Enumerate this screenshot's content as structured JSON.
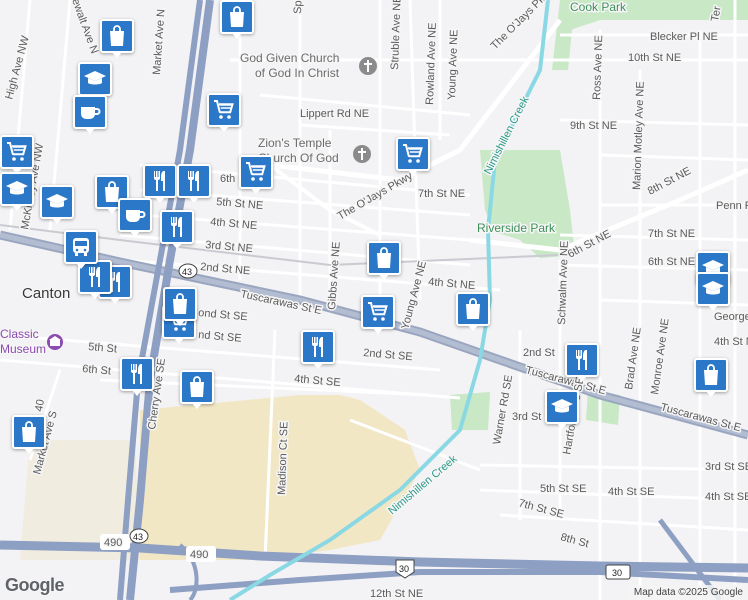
{
  "map": {
    "attribution": "Map data ©2025 Google",
    "logo_text": "Google",
    "city_label": "Canton",
    "museum_label": "Classic\nMuseum",
    "museum_label_lines": [
      "Classic",
      "Museum"
    ],
    "colors": {
      "background": "#f3f2f4",
      "park": "#c9e8c6",
      "industrial": "#f2e7c5",
      "water": "#8ad8e4",
      "highway": "#8d9fc2",
      "marker": "#2b77c8"
    },
    "places": {
      "church_1": [
        "God Given Church",
        "of God In Christ"
      ],
      "church_2": [
        "Zion's Temple",
        "Church Of God"
      ],
      "park_1": "Cook Park",
      "park_2": "Riverside Park",
      "creek": "Nimishillen Creek"
    },
    "streets": {
      "tuscarawas_w": "Tuscarawas St E",
      "tuscarawas_e": "Tuscarawas St E",
      "tuscarawas_far": "Tuscarawas St E",
      "oj_1": "The O'Jays Pkwy",
      "oj_2": "The O'Jays Pkwy",
      "market": "Market Ave N",
      "cherry": "Cherry Ave SE",
      "madison": "Madison Ct SE",
      "gibbs": "Gibbs Ave NE",
      "young_s": "Young Ave NE",
      "young_n": "Young Ave NE",
      "rowland": "Rowland Ave NE",
      "struble": "Struble Ave NE",
      "warner": "Warner Rd SE",
      "schwalm": "Schwalm Ave NE",
      "hartford": "Hartford Ave SE",
      "brad": "Brad Ave NE",
      "monroe": "Monroe Ave NE",
      "ross": "Ross Ave NE",
      "marion": "Marion Motley Ave NE",
      "high": "High Ave NW",
      "mckinley": "McKinley Ave NW",
      "market_s": "Market Ave S",
      "lippert": "Lippert Rd NE",
      "bleck": "Blecker Pl NE",
      "tenth": "10th St NE",
      "ninth": "9th St NE",
      "eighth": "8th St NE",
      "penn": "Penn Pl",
      "seventh_w": "7th St NE",
      "seventh_e": "7th St NE",
      "sixth_w": "6th St NE",
      "sixth_m": "6th St NE",
      "sixth_e": "6th St NE",
      "fifth": "5th St NE",
      "fourth_w": "4th St NE",
      "fourth_m": "4th St NE",
      "fourth_e": "4th St N",
      "third": "3rd St NE",
      "second_w": "2nd St NE",
      "second_se": "2nd St SE",
      "second_e": "2nd St",
      "second_e2": "2nd",
      "third_se_w": "3rd St SE",
      "third_se_e": "3rd St SE",
      "fourth_se": "4th St SE",
      "fourth_se_e": "4th St SE",
      "fifth_st": "5th St",
      "sixth_st": "6th St",
      "fifth_se": "5th St SE",
      "seventh_se": "7th St SE",
      "eighth_st": "8th St",
      "twelfth": "12th St NE",
      "fourth_st_se_w": "4th St SE",
      "george": "George",
      "fourth_n_e": "4th St N",
      "twond": "2nd St SE",
      "ond": "ond St SE",
      "nd": "nd St SE",
      "third_st_se": "3rd St SE",
      "sp": "Sp",
      "ewalt": "ewalt Ave N",
      "fourty": "40",
      "ter": "Ter"
    },
    "shields": {
      "i490_w": "490",
      "i490_e": "490",
      "us30_w": "30",
      "us30_e": "30",
      "sr43_n": "43",
      "sr43_s": "43"
    },
    "markers": [
      {
        "type": "restaurant",
        "icon": "fork-knife-icon",
        "id": "m1"
      },
      {
        "type": "restaurant",
        "icon": "fork-knife-icon",
        "id": "m2"
      },
      {
        "type": "restaurant",
        "icon": "fork-knife-icon",
        "id": "m3"
      },
      {
        "type": "restaurant",
        "icon": "fork-knife-icon",
        "id": "m4"
      },
      {
        "type": "restaurant",
        "icon": "fork-knife-icon",
        "id": "m5"
      },
      {
        "type": "restaurant",
        "icon": "fork-knife-icon",
        "id": "m6"
      },
      {
        "type": "restaurant",
        "icon": "fork-knife-icon",
        "id": "m7"
      },
      {
        "type": "restaurant",
        "icon": "fork-knife-icon",
        "id": "m8"
      },
      {
        "type": "grocery",
        "icon": "shopping-cart-icon",
        "id": "m9"
      },
      {
        "type": "grocery",
        "icon": "shopping-cart-icon",
        "id": "m10"
      },
      {
        "type": "grocery",
        "icon": "shopping-cart-icon",
        "id": "m11"
      },
      {
        "type": "grocery",
        "icon": "shopping-cart-icon",
        "id": "m12"
      },
      {
        "type": "grocery",
        "icon": "shopping-cart-icon",
        "id": "m13"
      },
      {
        "type": "grocery",
        "icon": "shopping-cart-icon",
        "id": "m14"
      },
      {
        "type": "shopping",
        "icon": "shopping-bag-icon",
        "id": "m15"
      },
      {
        "type": "shopping",
        "icon": "shopping-bag-icon",
        "id": "m16"
      },
      {
        "type": "shopping",
        "icon": "shopping-bag-icon",
        "id": "m17"
      },
      {
        "type": "shopping",
        "icon": "shopping-bag-icon",
        "id": "m18"
      },
      {
        "type": "shopping",
        "icon": "shopping-bag-icon",
        "id": "m19"
      },
      {
        "type": "shopping",
        "icon": "shopping-bag-icon",
        "id": "m20"
      },
      {
        "type": "shopping",
        "icon": "shopping-bag-icon",
        "id": "m21"
      },
      {
        "type": "shopping",
        "icon": "shopping-bag-icon",
        "id": "m22"
      },
      {
        "type": "shopping",
        "icon": "shopping-bag-icon",
        "id": "m23"
      },
      {
        "type": "school",
        "icon": "graduation-cap-icon",
        "id": "m24"
      },
      {
        "type": "school",
        "icon": "graduation-cap-icon",
        "id": "m25"
      },
      {
        "type": "school",
        "icon": "graduation-cap-icon",
        "id": "m26"
      },
      {
        "type": "school",
        "icon": "graduation-cap-icon",
        "id": "m27"
      },
      {
        "type": "school",
        "icon": "graduation-cap-icon",
        "id": "m28"
      },
      {
        "type": "school",
        "icon": "graduation-cap-icon",
        "id": "m29"
      },
      {
        "type": "cafe",
        "icon": "coffee-cup-icon",
        "id": "m30"
      },
      {
        "type": "cafe",
        "icon": "coffee-cup-icon",
        "id": "m31"
      },
      {
        "type": "transit",
        "icon": "bus-icon",
        "id": "m32"
      }
    ]
  }
}
